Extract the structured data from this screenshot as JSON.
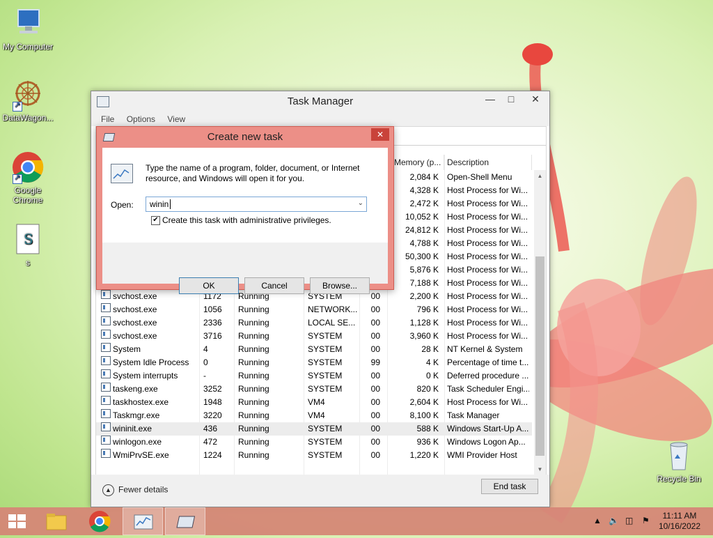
{
  "desktop": {
    "icons": [
      {
        "label": "My Computer"
      },
      {
        "label": "DataWagon..."
      },
      {
        "label": "Google Chrome"
      },
      {
        "label": "s"
      },
      {
        "label": "Recycle Bin"
      }
    ]
  },
  "task_manager": {
    "title": "Task Manager",
    "menu": [
      "File",
      "Options",
      "View"
    ],
    "columns": {
      "memory": "Memory (p...",
      "description": "Description"
    },
    "rows_partial": [
      {
        "memory": "2,084 K",
        "description": "Open-Shell Menu"
      },
      {
        "memory": "4,328 K",
        "description": "Host Process for Wi..."
      },
      {
        "memory": "2,472 K",
        "description": "Host Process for Wi..."
      },
      {
        "memory": "10,052 K",
        "description": "Host Process for Wi..."
      },
      {
        "memory": "24,812 K",
        "description": "Host Process for Wi..."
      },
      {
        "memory": "4,788 K",
        "description": "Host Process for Wi..."
      },
      {
        "memory": "50,300 K",
        "description": "Host Process for Wi..."
      },
      {
        "memory": "5,876 K",
        "description": "Host Process for Wi..."
      },
      {
        "memory": "7,188 K",
        "description": "Host Process for Wi..."
      }
    ],
    "rows": [
      {
        "name": "svchost.exe",
        "pid": "1172",
        "status": "Running",
        "user": "SYSTEM",
        "cpu": "00",
        "memory": "2,200 K",
        "description": "Host Process for Wi..."
      },
      {
        "name": "svchost.exe",
        "pid": "1056",
        "status": "Running",
        "user": "NETWORK...",
        "cpu": "00",
        "memory": "796 K",
        "description": "Host Process for Wi..."
      },
      {
        "name": "svchost.exe",
        "pid": "2336",
        "status": "Running",
        "user": "LOCAL SE...",
        "cpu": "00",
        "memory": "1,128 K",
        "description": "Host Process for Wi..."
      },
      {
        "name": "svchost.exe",
        "pid": "3716",
        "status": "Running",
        "user": "SYSTEM",
        "cpu": "00",
        "memory": "3,960 K",
        "description": "Host Process for Wi..."
      },
      {
        "name": "System",
        "pid": "4",
        "status": "Running",
        "user": "SYSTEM",
        "cpu": "00",
        "memory": "28 K",
        "description": "NT Kernel & System"
      },
      {
        "name": "System Idle Process",
        "pid": "0",
        "status": "Running",
        "user": "SYSTEM",
        "cpu": "99",
        "memory": "4 K",
        "description": "Percentage of time t..."
      },
      {
        "name": "System interrupts",
        "pid": "-",
        "status": "Running",
        "user": "SYSTEM",
        "cpu": "00",
        "memory": "0 K",
        "description": "Deferred procedure ..."
      },
      {
        "name": "taskeng.exe",
        "pid": "3252",
        "status": "Running",
        "user": "SYSTEM",
        "cpu": "00",
        "memory": "820 K",
        "description": "Task Scheduler Engi..."
      },
      {
        "name": "taskhostex.exe",
        "pid": "1948",
        "status": "Running",
        "user": "VM4",
        "cpu": "00",
        "memory": "2,604 K",
        "description": "Host Process for Wi..."
      },
      {
        "name": "Taskmgr.exe",
        "pid": "3220",
        "status": "Running",
        "user": "VM4",
        "cpu": "00",
        "memory": "8,100 K",
        "description": "Task Manager"
      },
      {
        "name": "wininit.exe",
        "pid": "436",
        "status": "Running",
        "user": "SYSTEM",
        "cpu": "00",
        "memory": "588 K",
        "description": "Windows Start-Up A..."
      },
      {
        "name": "winlogon.exe",
        "pid": "472",
        "status": "Running",
        "user": "SYSTEM",
        "cpu": "00",
        "memory": "936 K",
        "description": "Windows Logon Ap..."
      },
      {
        "name": "WmiPrvSE.exe",
        "pid": "1224",
        "status": "Running",
        "user": "SYSTEM",
        "cpu": "00",
        "memory": "1,220 K",
        "description": "WMI Provider Host"
      }
    ],
    "fewer_details": "Fewer details",
    "end_task": "End task"
  },
  "dialog": {
    "title": "Create new task",
    "message": "Type the name of a program, folder, document, or Internet resource, and Windows will open it for you.",
    "open_label": "Open:",
    "open_value": "winin",
    "admin_checkbox": "Create this task with administrative privileges.",
    "admin_checked": true,
    "ok": "OK",
    "cancel": "Cancel",
    "browse": "Browse..."
  },
  "taskbar": {
    "time": "11:11 AM",
    "date": "10/16/2022"
  },
  "colors": {
    "taskbar": "#d68476",
    "dialog_frame": "#ec8f87",
    "close_red": "#c9433a"
  }
}
